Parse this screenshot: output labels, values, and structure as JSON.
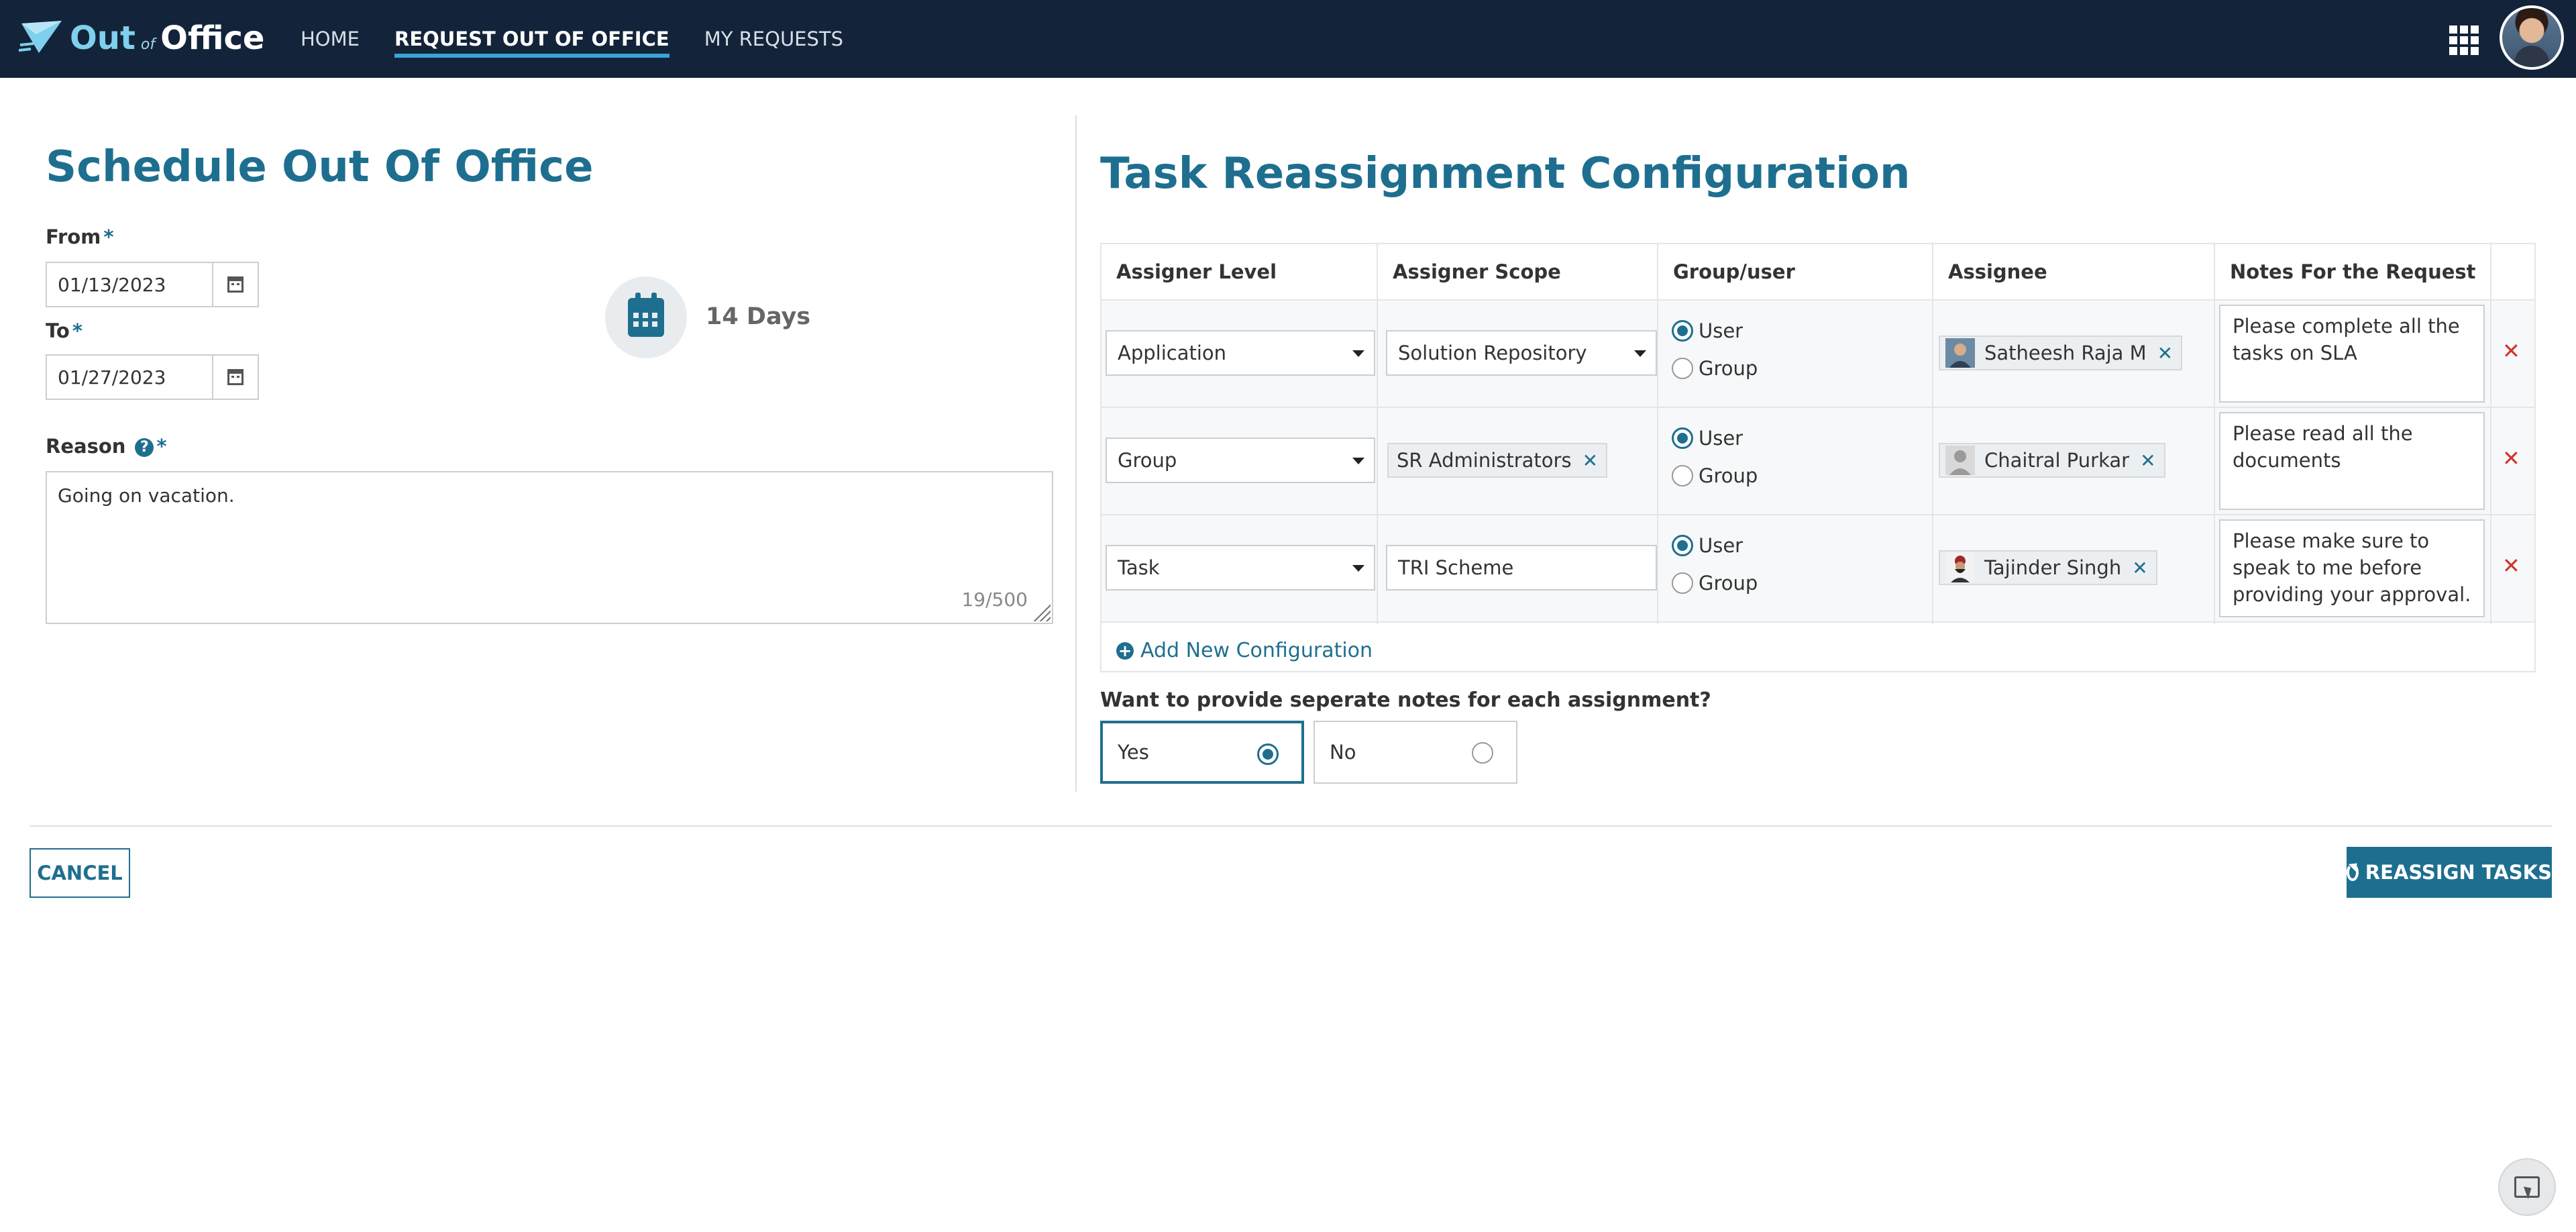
{
  "app": {
    "logo_out": "Out",
    "logo_of": "of",
    "logo_office": "Office"
  },
  "nav": {
    "items": [
      {
        "label": "HOME",
        "active": false
      },
      {
        "label": "REQUEST OUT OF OFFICE",
        "active": true
      },
      {
        "label": "MY REQUESTS",
        "active": false
      }
    ],
    "apps_icon": "grid-icon",
    "avatar_icon": "user-avatar"
  },
  "schedule": {
    "title": "Schedule Out Of Office",
    "from_label": "From",
    "from_value": "01/13/2023",
    "to_label": "To",
    "to_value": "01/27/2023",
    "required_mark": "*",
    "duration": "14 Days",
    "reason_label": "Reason",
    "reason_value": "Going on vacation.",
    "reason_count": "19/500"
  },
  "config": {
    "title": "Task Reassignment Configuration",
    "columns": [
      "Assigner Level",
      "Assigner Scope",
      "Group/user",
      "Assignee",
      "Notes For the Request"
    ],
    "rows": [
      {
        "level": "Application",
        "scope": "Solution Repository",
        "scope_type": "select",
        "option_user": "User",
        "option_group": "Group",
        "selected": "User",
        "assignee": "Satheesh Raja M",
        "notes": "Please complete all the tasks on SLA"
      },
      {
        "level": "Group",
        "scope": "SR Administrators",
        "scope_type": "tag",
        "option_user": "User",
        "option_group": "Group",
        "selected": "User",
        "assignee": "Chaitral Purkar",
        "notes": "Please read all the documents"
      },
      {
        "level": "Task",
        "scope": "TRI Scheme",
        "scope_type": "input",
        "option_user": "User",
        "option_group": "Group",
        "selected": "User",
        "assignee": "Tajinder Singh",
        "notes": "Please make sure to speak to me before providing your approval."
      }
    ],
    "add_label": "Add New Configuration",
    "remove_icon": "close-icon"
  },
  "separate_notes": {
    "question": "Want to provide seperate notes for each assignment?",
    "yes_label": "Yes",
    "no_label": "No",
    "selected": "Yes"
  },
  "actions": {
    "cancel_label": "CANCEL",
    "reassign_label": "REASSIGN TASKS"
  },
  "colors": {
    "topbar": "#13243a",
    "accent": "#1e6f8f",
    "danger": "#d0342c"
  }
}
